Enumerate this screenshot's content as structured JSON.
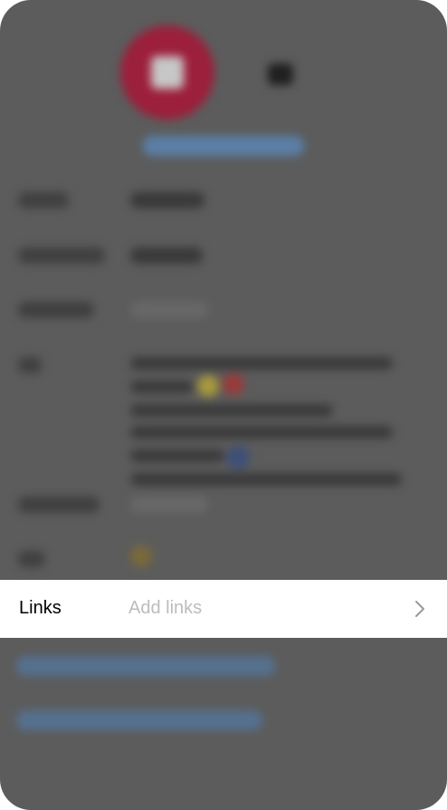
{
  "links_row": {
    "label": "Links",
    "placeholder": "Add links",
    "chevron_icon": "chevron-right-icon"
  },
  "colors": {
    "overlay": "#5c5c5c",
    "avatar": "#9c1f3b",
    "link_blue": "#5b7fa8",
    "placeholder": "#bcbcbc"
  }
}
